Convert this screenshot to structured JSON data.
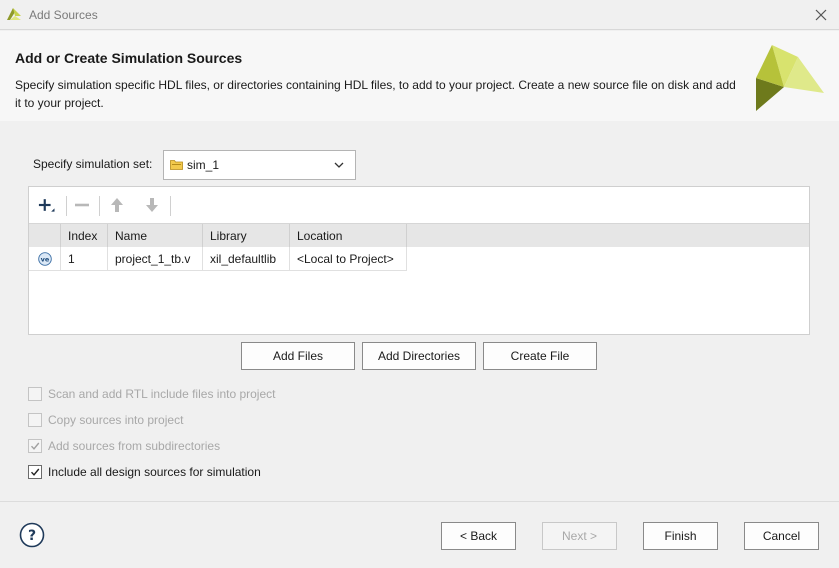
{
  "window": {
    "title": "Add Sources"
  },
  "header": {
    "title": "Add or Create Simulation Sources",
    "description": "Specify simulation specific HDL files, or directories containing HDL files, to add to your project. Create a new source file on disk and add it to your project."
  },
  "simset": {
    "label": "Specify simulation set:",
    "value": "sim_1"
  },
  "table": {
    "columns": [
      "Index",
      "Name",
      "Library",
      "Location"
    ],
    "rows": [
      {
        "index": "1",
        "name": "project_1_tb.v",
        "library": "xil_defaultlib",
        "location": "<Local to Project>"
      }
    ]
  },
  "actions": {
    "add_files": "Add Files",
    "add_directories": "Add Directories",
    "create_file": "Create File"
  },
  "options": [
    {
      "label": "Scan and add RTL include files into project",
      "checked": false,
      "enabled": false
    },
    {
      "label": "Copy sources into project",
      "checked": false,
      "enabled": false
    },
    {
      "label": "Add sources from subdirectories",
      "checked": true,
      "enabled": false
    },
    {
      "label": "Include all design sources for simulation",
      "checked": true,
      "enabled": true
    }
  ],
  "footer": {
    "help": "?",
    "back": "< Back",
    "next": "Next >",
    "finish": "Finish",
    "cancel": "Cancel"
  },
  "colors": {
    "logo_dark": "#6e7a1c",
    "logo_light": "#d8e36e",
    "accent": "#0b6ebd"
  }
}
